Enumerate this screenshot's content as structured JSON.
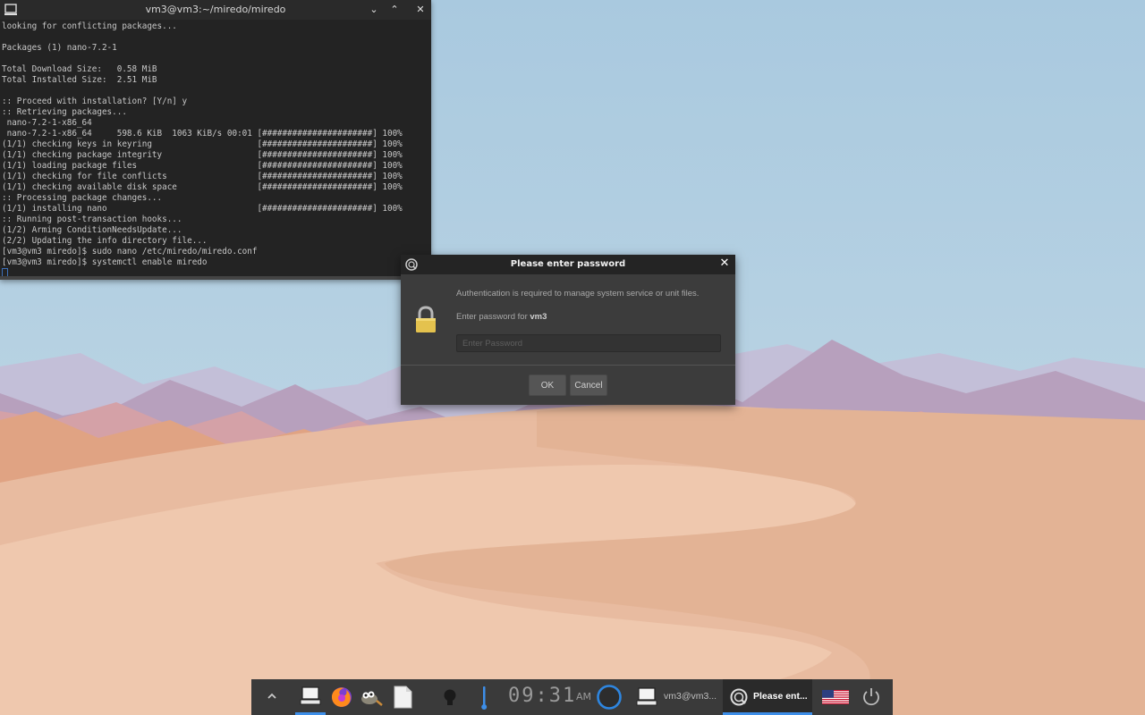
{
  "terminal": {
    "title": "vm3@vm3:~/miredo/miredo",
    "lines": [
      "looking for conflicting packages...",
      "",
      "Packages (1) nano-7.2-1",
      "",
      "Total Download Size:   0.58 MiB",
      "Total Installed Size:  2.51 MiB",
      "",
      ":: Proceed with installation? [Y/n] y",
      ":: Retrieving packages...",
      " nano-7.2-1-x86_64",
      " nano-7.2-1-x86_64     598.6 KiB  1063 KiB/s 00:01 [######################] 100%",
      "(1/1) checking keys in keyring                     [######################] 100%",
      "(1/1) checking package integrity                   [######################] 100%",
      "(1/1) loading package files                        [######################] 100%",
      "(1/1) checking for file conflicts                  [######################] 100%",
      "(1/1) checking available disk space                [######################] 100%",
      ":: Processing package changes...",
      "(1/1) installing nano                              [######################] 100%",
      ":: Running post-transaction hooks...",
      "(1/2) Arming ConditionNeedsUpdate...",
      "(2/2) Updating the info directory file...",
      "[vm3@vm3 miredo]$ sudo nano /etc/miredo/miredo.conf",
      "[vm3@vm3 miredo]$ systemctl enable miredo"
    ],
    "buttons": {
      "minimize": "⌄",
      "maximize": "⌃",
      "close": "✕"
    }
  },
  "dialog": {
    "title": "Please enter password",
    "close": "✕",
    "auth_message": "Authentication is required to manage system service or unit files.",
    "prompt_prefix": "Enter password for ",
    "user": "vm3",
    "password_placeholder": "Enter Password",
    "password_value": "",
    "ok_label": "OK",
    "cancel_label": "Cancel"
  },
  "taskbar": {
    "clock": "09:31",
    "ampm": "AM",
    "task_terminal_label": "vm3@vm3...",
    "task_dialog_label": "Please ent...",
    "icons": [
      "chevron-up-icon",
      "terminal-icon",
      "firefox-icon",
      "gimp-icon",
      "text-editor-icon",
      "bulb-icon",
      "thermometer-icon",
      "circle-icon",
      "us-flag-icon",
      "power-icon"
    ]
  },
  "colors": {
    "sky": "#b4cfe0",
    "sand": "#e8c0a4",
    "accent": "#3d8ee8",
    "dialog_bg": "#3c3c3c"
  }
}
